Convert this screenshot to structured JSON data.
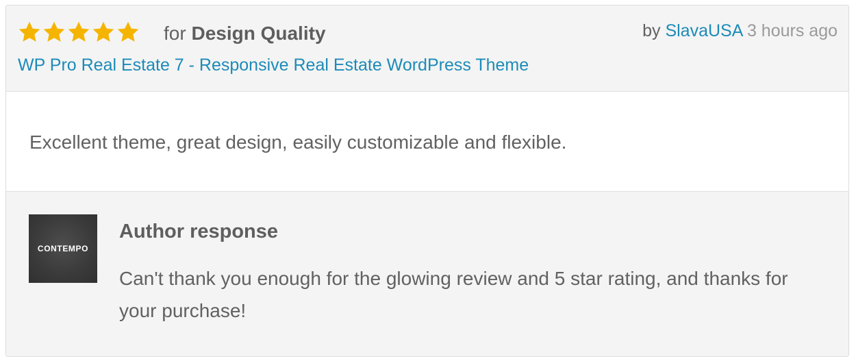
{
  "rating": {
    "stars": 5,
    "max_stars": 5,
    "star_color": "#f5b400",
    "prefix": "for",
    "category": "Design Quality"
  },
  "byline": {
    "prefix": "by",
    "user": "SlavaUSA",
    "time": "3 hours ago"
  },
  "item": {
    "title": "WP Pro Real Estate 7 - Responsive Real Estate WordPress Theme"
  },
  "review": {
    "text": "Excellent theme, great design, easily customizable and flexible."
  },
  "author_response": {
    "avatar_label": "CONTEMPO",
    "title": "Author response",
    "text": "Can't thank you enough for the glowing review and 5 star rating, and thanks for your purchase!"
  },
  "colors": {
    "link": "#1c8bb8",
    "text": "#616161",
    "muted": "#9a9a9a",
    "panel_bg": "#f4f4f4"
  }
}
